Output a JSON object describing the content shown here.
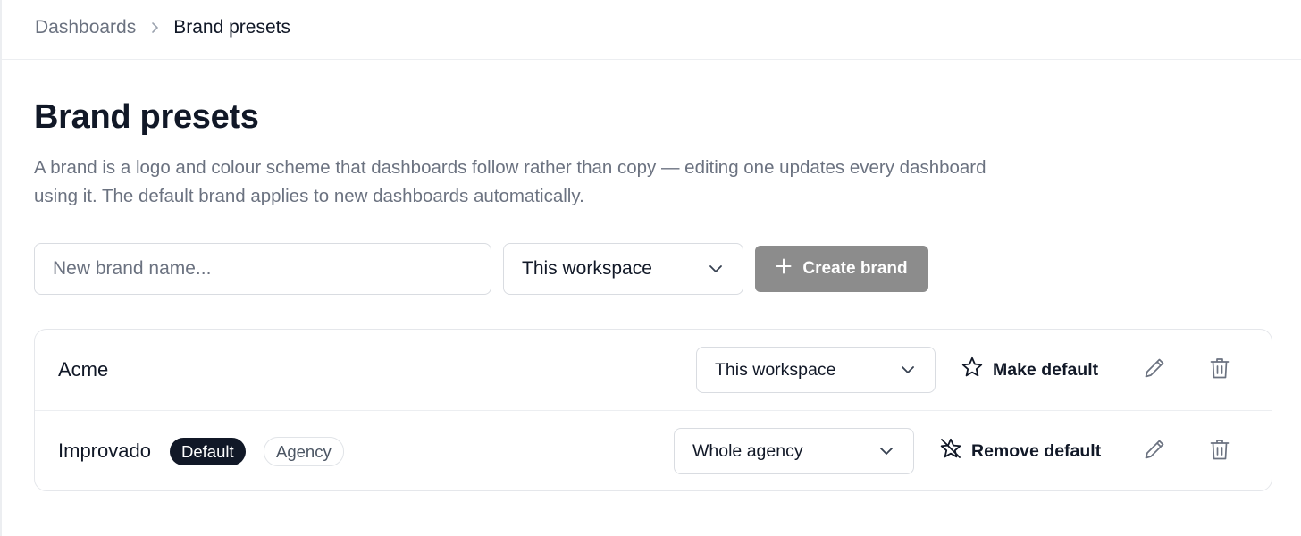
{
  "breadcrumb": {
    "parent": "Dashboards",
    "current": "Brand presets"
  },
  "page": {
    "title": "Brand presets",
    "description": "A brand is a logo and colour scheme that dashboards follow rather than copy — editing one updates every dashboard using it. The default brand applies to new dashboards automatically."
  },
  "create_form": {
    "name_placeholder": "New brand name...",
    "name_value": "",
    "scope_selected": "This workspace",
    "create_label": "Create brand"
  },
  "brands": [
    {
      "name": "Acme",
      "is_default": false,
      "scope": "This workspace",
      "default_action": "Make default"
    },
    {
      "name": "Improvado",
      "is_default": true,
      "default_badge": "Default",
      "scope_badge": "Agency",
      "scope": "Whole agency",
      "default_action": "Remove default"
    }
  ],
  "icons": {
    "breadcrumb_separator": "chevron-right-icon",
    "select_chevron": "chevron-down-icon",
    "create": "plus-icon",
    "make_default": "star-icon",
    "remove_default": "star-off-icon",
    "edit": "pencil-icon",
    "delete": "trash-icon"
  },
  "colors": {
    "text_primary": "#111827",
    "text_muted": "#6b7280",
    "create_button_disabled": "#8c8c8c",
    "default_badge_bg": "#111827",
    "border": "#d9dce1"
  }
}
